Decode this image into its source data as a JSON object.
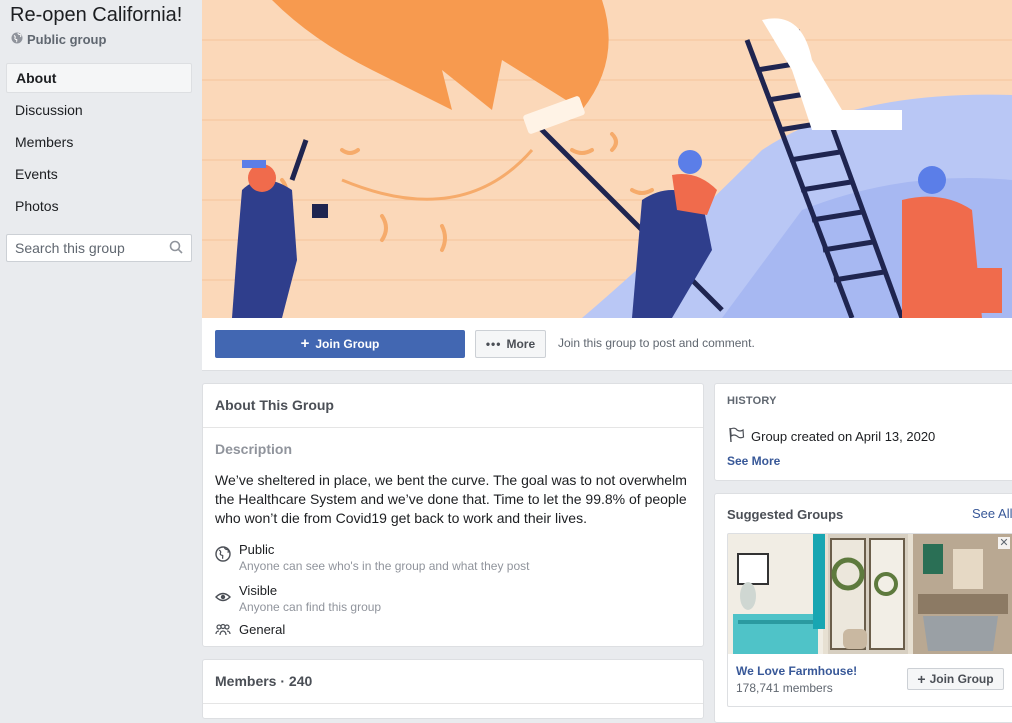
{
  "group": {
    "title": "Re-open California!",
    "type_label": "Public group"
  },
  "sidebar": {
    "items": [
      {
        "label": "About",
        "active": true
      },
      {
        "label": "Discussion"
      },
      {
        "label": "Members"
      },
      {
        "label": "Events"
      },
      {
        "label": "Photos"
      }
    ],
    "search_placeholder": "Search this group"
  },
  "join_bar": {
    "join_label": "Join Group",
    "more_label": "More",
    "hint": "Join this group to post and comment."
  },
  "about": {
    "heading": "About This Group",
    "description_label": "Description",
    "description": "We’ve sheltered in place, we bent the curve.  The goal was to not overwhelm the Healthcare System and we’ve done that.  Time to let the 99.8% of people who won’t die from Covid19 get back to work and their lives.",
    "privacy_title": "Public",
    "privacy_sub": "Anyone can see who's in the group and what they post",
    "visibility_title": "Visible",
    "visibility_sub": "Anyone can find this group",
    "category": "General"
  },
  "members": {
    "heading": "Members · 240"
  },
  "history": {
    "label": "HISTORY",
    "created": "Group created on April 13, 2020",
    "see_more": "See More"
  },
  "suggested": {
    "heading": "Suggested Groups",
    "see_all": "See All",
    "group_name": "We Love Farmhouse!",
    "member_count": "178,741 members",
    "join_label": "Join Group"
  },
  "colors": {
    "brand_blue": "#4267b2",
    "link_blue": "#385898",
    "background": "#e9ebee"
  }
}
